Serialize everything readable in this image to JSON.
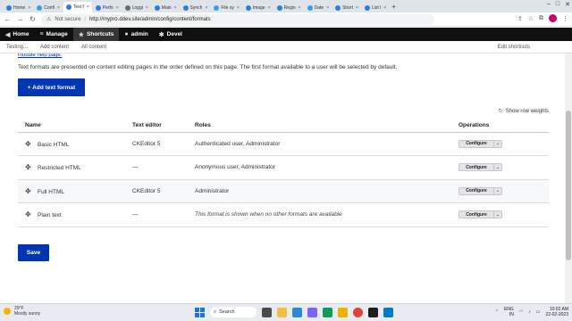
{
  "browser": {
    "tabs": [
      {
        "label": "Home",
        "active": false
      },
      {
        "label": "Confi",
        "active": false
      },
      {
        "label": "Text f",
        "active": true
      },
      {
        "label": "Perfo",
        "active": false
      },
      {
        "label": "Loggi",
        "active": false
      },
      {
        "label": "Main",
        "active": false
      },
      {
        "label": "Synch",
        "active": false
      },
      {
        "label": "File sy",
        "active": false
      },
      {
        "label": "Image",
        "active": false
      },
      {
        "label": "Regio",
        "active": false
      },
      {
        "label": "Date",
        "active": false
      },
      {
        "label": "Short",
        "active": false
      },
      {
        "label": "List l",
        "active": false
      }
    ],
    "security_label": "Not secure",
    "url": "http://mypro.ddev.site/admin/config/content/formats"
  },
  "toolbar": {
    "home": "Home",
    "manage": "Manage",
    "shortcuts": "Shortcuts",
    "admin": "admin",
    "devel": "Devel"
  },
  "shortcut_tray": {
    "items": [
      "Testing...",
      "Add content",
      "All content"
    ],
    "edit": "Edit shortcuts"
  },
  "main": {
    "help_link": "module help page.",
    "description": "Text formats are presented on content editing pages in the order defined on this page. The first format available to a user will be selected by default.",
    "add_button": "+ Add text format",
    "row_weights": "Show row weights",
    "columns": [
      "Name",
      "Text editor",
      "Roles",
      "Operations"
    ],
    "rows": [
      {
        "name": "Basic HTML",
        "editor": "CKEditor 5",
        "roles": "Authenticated user, Administrator",
        "roles_italic": false,
        "op": "Configure"
      },
      {
        "name": "Restricted HTML",
        "editor": "—",
        "roles": "Anonymous user, Administrator",
        "roles_italic": false,
        "op": "Configure"
      },
      {
        "name": "Full HTML",
        "editor": "CKEditor 5",
        "roles": "Administrator",
        "roles_italic": false,
        "op": "Configure"
      },
      {
        "name": "Plain text",
        "editor": "—",
        "roles": "This format is shown when no other formats are available",
        "roles_italic": true,
        "op": "Configure"
      }
    ],
    "save_button": "Save"
  },
  "taskbar": {
    "temp": "29°F",
    "weather": "Mostly sunny",
    "search": "Search",
    "lang": "ENG",
    "region": "IN",
    "time": "10:02 AM",
    "date": "22-02-2023"
  }
}
